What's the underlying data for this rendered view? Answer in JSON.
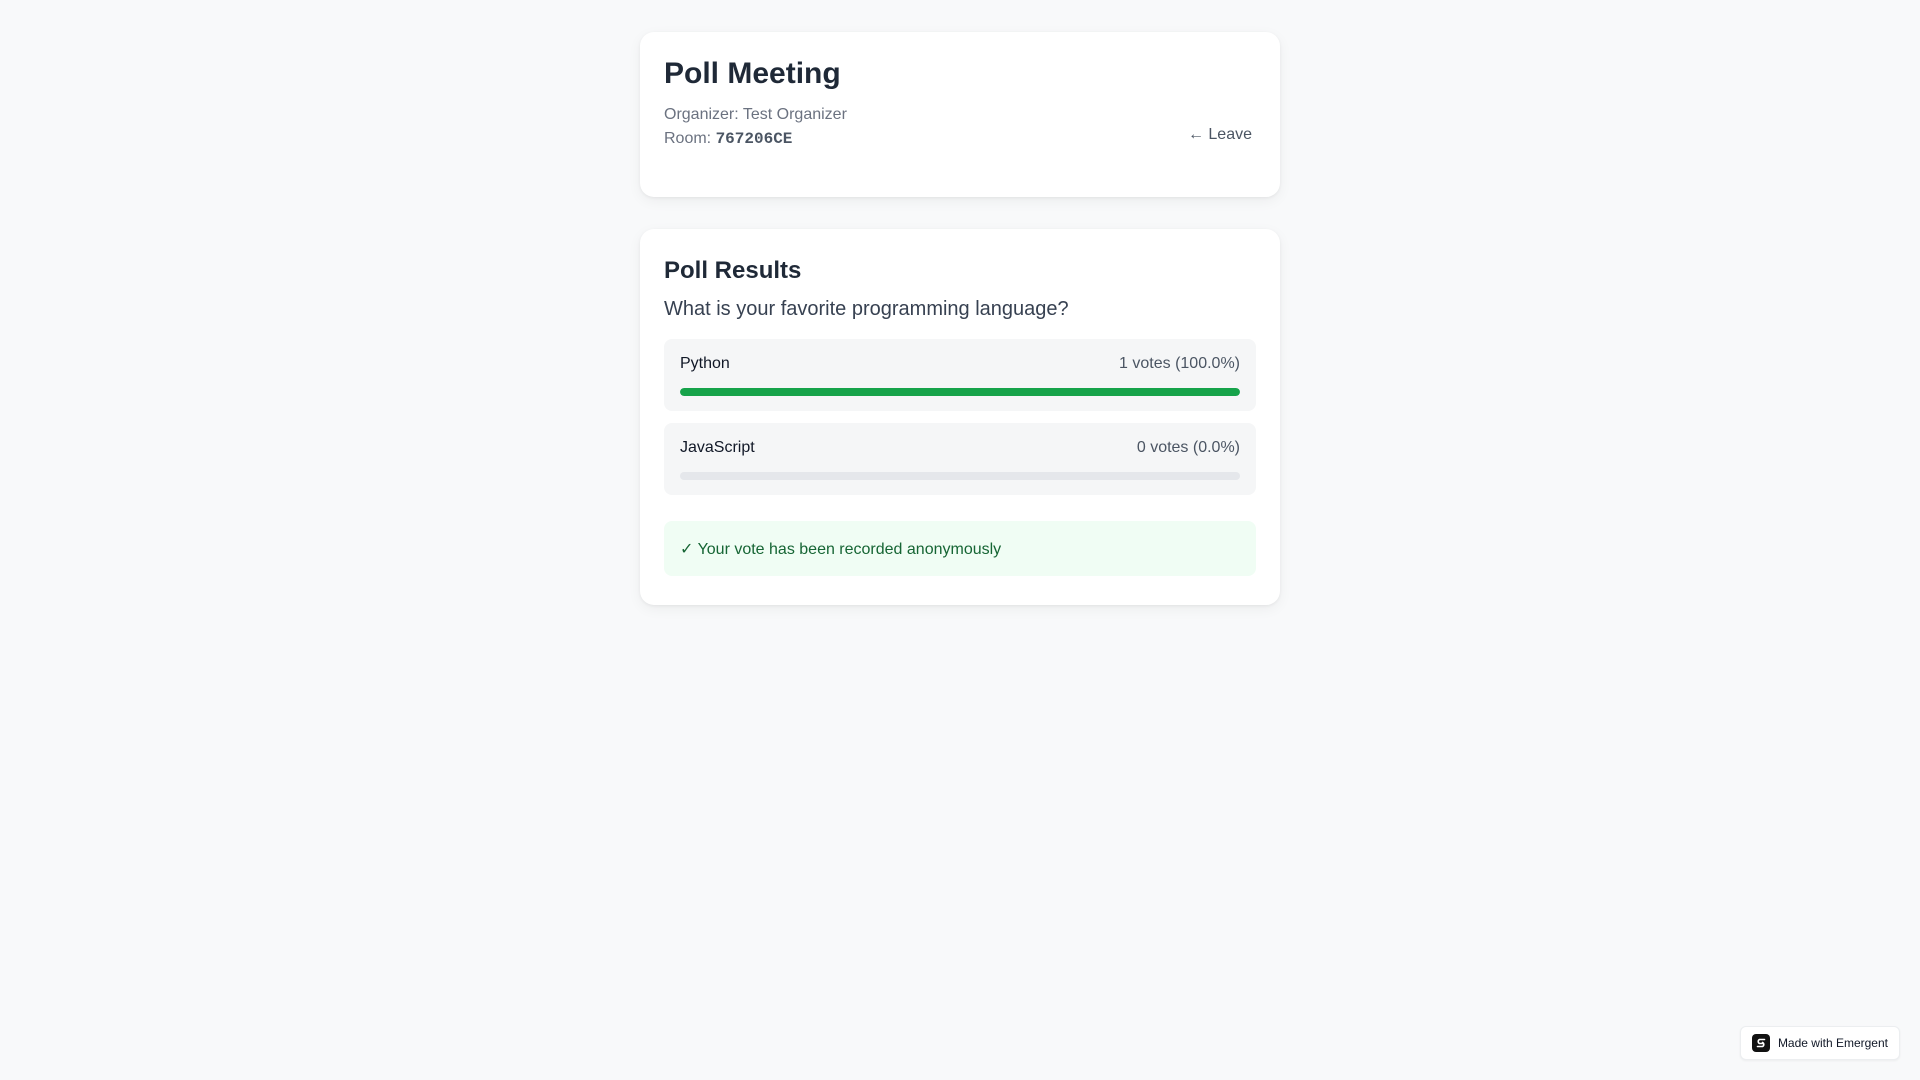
{
  "meeting": {
    "title": "Poll Meeting",
    "organizer_label": "Organizer: ",
    "organizer_name": "Test Organizer",
    "room_label": "Room: ",
    "room_code": "767206CE",
    "leave_label": "← Leave"
  },
  "poll": {
    "results_title": "Poll Results",
    "question": "What is your favorite programming language?",
    "options": [
      {
        "label": "Python",
        "votes_text": "1 votes (100.0%)",
        "percent": 100.0
      },
      {
        "label": "JavaScript",
        "votes_text": "0 votes (0.0%)",
        "percent": 0.0
      }
    ],
    "confirmation": "✓ Your vote has been recorded anonymously"
  },
  "badge": {
    "label": "Made with Emergent",
    "icon": "emergent-logo-icon"
  },
  "colors": {
    "background": "#f8f9fa",
    "bar_fill": "#16a34a",
    "bar_track": "#e5e7eb",
    "notice_bg": "#f0fdf4",
    "notice_text": "#166534"
  }
}
